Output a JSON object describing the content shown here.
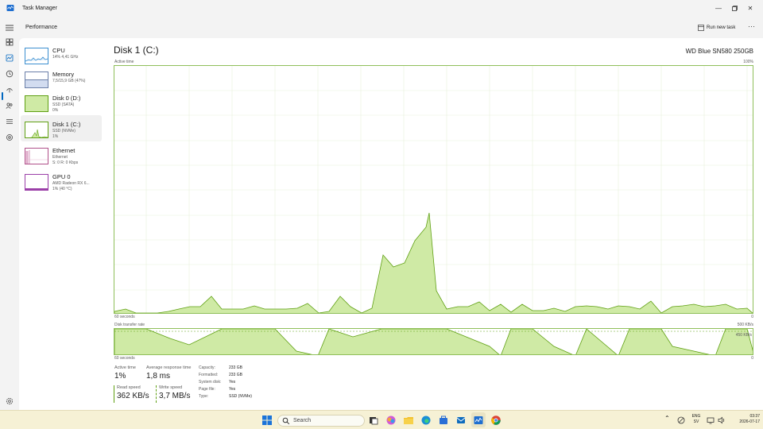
{
  "window": {
    "title": "Task Manager"
  },
  "command_bar": {
    "page_title": "Performance",
    "run_new_task": "Run new task",
    "more": "···"
  },
  "nav_icons": [
    "processes-icon",
    "performance-icon",
    "app-history-icon",
    "startup-apps-icon",
    "users-icon",
    "details-icon",
    "services-icon"
  ],
  "perf_list": [
    {
      "name": "CPU",
      "sub1": "14% 4,41 GHz",
      "sub2": "",
      "sub3": ""
    },
    {
      "name": "Memory",
      "sub1": "7,5/15,9 GB (47%)",
      "sub2": "",
      "sub3": ""
    },
    {
      "name": "Disk 0 (D:)",
      "sub1": "SSD (SATA)",
      "sub2": "0%",
      "sub3": ""
    },
    {
      "name": "Disk 1 (C:)",
      "sub1": "SSD (NVMe)",
      "sub2": "1%",
      "sub3": ""
    },
    {
      "name": "Ethernet",
      "sub1": "Ethernet",
      "sub2": "S: 0 R: 0 Kbps",
      "sub3": ""
    },
    {
      "name": "GPU 0",
      "sub1": "AMD Radeon RX 6...",
      "sub2": "1% (40 °C)",
      "sub3": ""
    }
  ],
  "detail": {
    "title": "Disk 1 (C:)",
    "model": "WD Blue SN580 250GB",
    "graph1_label": "Active time",
    "graph1_max": "100%",
    "graph1_time": "60 seconds",
    "graph1_min": "0",
    "graph2_label": "Disk transfer rate",
    "graph2_max": "500 KB/s",
    "graph2_mid": "450 KB/s",
    "graph2_time": "60 seconds",
    "graph2_min": "0"
  },
  "stats": {
    "active_time_label": "Active time",
    "active_time_value": "1%",
    "response_label": "Average response time",
    "response_value": "1,8 ms",
    "read_label": "Read speed",
    "read_value": "362 KB/s",
    "write_label": "Write speed",
    "write_value": "3,7 MB/s"
  },
  "properties": [
    {
      "label": "Capacity:",
      "value": "233 GB"
    },
    {
      "label": "Formatted:",
      "value": "233 GB"
    },
    {
      "label": "System disk:",
      "value": "Yes"
    },
    {
      "label": "Page file:",
      "value": "Yes"
    },
    {
      "label": "Type:",
      "value": "SSD (NVMe)"
    }
  ],
  "taskbar": {
    "search_placeholder": "Search",
    "lang1": "ENG",
    "lang2": "SV",
    "time": "03:37",
    "date": "2026-07-17"
  },
  "colors": {
    "disk_fill": "#cfeaa5",
    "disk_line": "#5fa012",
    "accent": "#0067c0"
  }
}
